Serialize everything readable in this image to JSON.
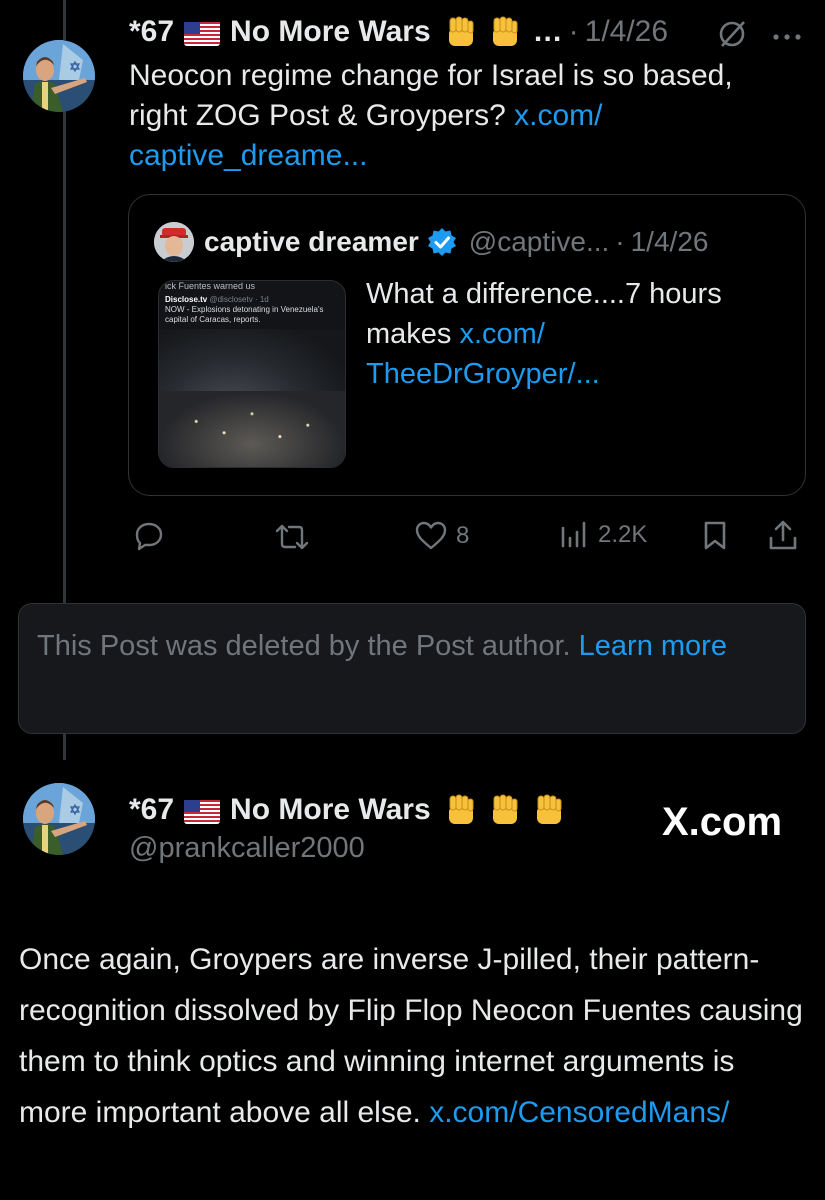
{
  "colors": {
    "background": "#000000",
    "text": "#e7e9ea",
    "muted": "#71767b",
    "link": "#1d9bf0",
    "verified": "#1d9bf0"
  },
  "post1": {
    "author_prefix": "*67",
    "author_name": "No More Wars",
    "author_suffix": "…",
    "date": "1/4/26",
    "text": "Neocon regime change for Israel is so based, right ZOG Post & Groypers?",
    "link_line1": "x.com/",
    "link_line2": "captive_dreame...",
    "icons": [
      "us-flag-icon",
      "raised-fist-icon",
      "raised-fist-icon",
      "grok-icon",
      "more-icon"
    ]
  },
  "quote": {
    "author_name": "captive dreamer",
    "handle": "@captive...",
    "date": "1/4/26",
    "text": "What a difference....7 hours makes",
    "link_line1": "x.com/",
    "link_line2": "TheeDrGroyper/...",
    "thumbnail": {
      "caption": "ick Fuentes warned us",
      "source_name": "Disclose.tv",
      "source_handle": "@disclosetv · 1d",
      "headline": "NOW - Explosions detonating in Venezuela's capital of Caracas, reports."
    }
  },
  "actions": {
    "likes": "8",
    "views": "2.2K",
    "icons": [
      "reply-icon",
      "repost-icon",
      "like-icon",
      "views-icon",
      "bookmark-icon",
      "share-icon"
    ]
  },
  "deleted": {
    "text": "This Post was deleted by the Post author.",
    "learn_more": "Learn more"
  },
  "post2": {
    "author_prefix": "*67",
    "author_name": "No More Wars",
    "handle": "@prankcaller2000",
    "watermark": "X.com",
    "text": "Once again, Groypers are inverse J-pilled, their pattern-recognition dissolved by Flip Flop Neocon Fuentes causing them to think optics and winning internet arguments is more important above all else.",
    "link": "x.com/CensoredMans/"
  }
}
